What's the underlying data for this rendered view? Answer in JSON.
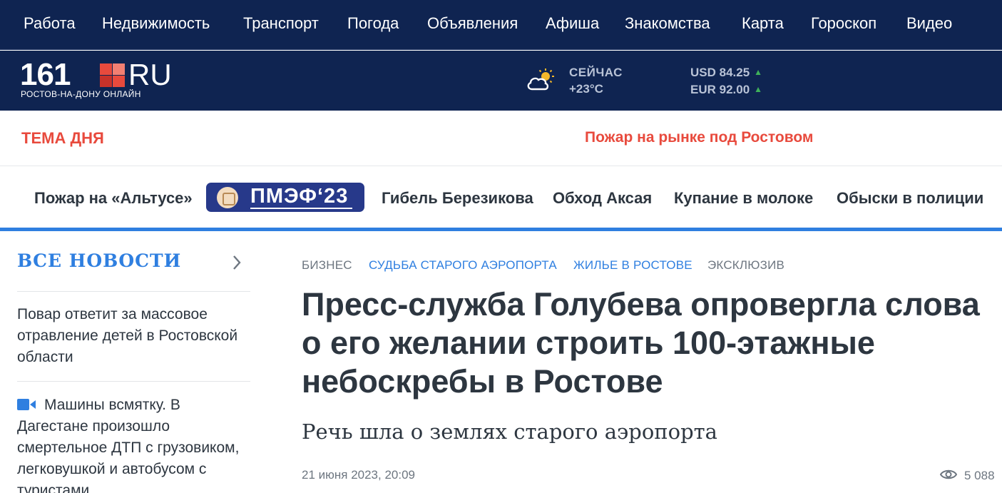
{
  "topnav": {
    "items": [
      {
        "label": "Работа"
      },
      {
        "label": "Недвижимость"
      },
      {
        "label": "Транспорт"
      },
      {
        "label": "Погода"
      },
      {
        "label": "Объявления"
      },
      {
        "label": "Афиша"
      },
      {
        "label": "Знакомства"
      },
      {
        "label": "Карта"
      },
      {
        "label": "Гороскоп"
      },
      {
        "label": "Видео"
      }
    ]
  },
  "header": {
    "logo_number": "161",
    "logo_domain": "RU",
    "logo_subtitle": "РОСТОВ-НА-ДОНУ ОНЛАЙН",
    "weather": {
      "label": "СЕЙЧАС",
      "temperature": "+23°C",
      "icon": "partly-cloudy-icon"
    },
    "rates": [
      {
        "text": "USD 84.25",
        "trend": "up"
      },
      {
        "text": "EUR 92.00",
        "trend": "up"
      }
    ],
    "colors": {
      "background": "#0f2451",
      "accent_red": "#e84a3d",
      "trend_up": "#3fb15a"
    }
  },
  "topic": {
    "label": "ТЕМА ДНЯ",
    "link": "Пожар на рынке под Ростовом"
  },
  "tags": {
    "first": "Пожар на «Альтусе»",
    "promo": "ПМЭФ‘23",
    "items": [
      "Гибель Березикова",
      "Обход Аксая",
      "Купание в молоке",
      "Обыски в полиции"
    ]
  },
  "sidebar": {
    "title": "ВСЕ НОВОСТИ",
    "news": [
      {
        "text": "Повар ответит за массовое отравление детей в Ростовской области",
        "video": false
      },
      {
        "text": "Машины всмятку. В Дагестане произошло смертельное ДТП с грузовиком, легковушкой и автобусом с туристами",
        "video": true
      }
    ]
  },
  "article": {
    "rubrics": [
      {
        "label": "БИЗНЕС",
        "style": "gray"
      },
      {
        "label": "СУДЬБА СТАРОГО АЭРОПОРТА",
        "style": "blue"
      },
      {
        "label": "ЖИЛЬЕ В РОСТОВЕ",
        "style": "blue"
      },
      {
        "label": "ЭКСКЛЮЗИВ",
        "style": "gray"
      }
    ],
    "headline": "Пресс-служба Голубева опровергла слова о его желании строить 100-этажные небоскребы в Ростове",
    "subtitle": "Речь шла о землях старого аэропорта",
    "date": "21 июня 2023, 20:09",
    "views": "5 088",
    "accent_blue": "#2f7fe0"
  }
}
